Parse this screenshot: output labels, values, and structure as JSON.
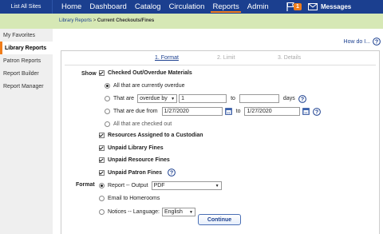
{
  "topbar": {
    "site": "List All Sites",
    "nav": [
      "Home",
      "Dashboard",
      "Catalog",
      "Circulation",
      "Reports",
      "Admin"
    ],
    "active_nav": "Reports",
    "badge": "1",
    "messages": "Messages"
  },
  "breadcrumb": {
    "parent": "Library Reports",
    "sep": ">",
    "current": "Current Checkouts/Fines"
  },
  "sidebar": {
    "items": [
      "My Favorites",
      "Library Reports",
      "Patron Reports",
      "Report Builder",
      "Report Manager"
    ],
    "active": "Library Reports"
  },
  "howdo": "How do I...",
  "steps": [
    "1. Format",
    "2. Limit",
    "3. Details"
  ],
  "show": {
    "label": "Show",
    "checked_out": "Checked Out/Overdue Materials",
    "opt_all_overdue": "All that are currently overdue",
    "opt_that_are": "That are",
    "overdue_by": "overdue by",
    "overdue_from": "1",
    "to_label": "to",
    "overdue_to": "",
    "days": "days",
    "opt_due_from": "That are due from",
    "date_from": "1/27/2020",
    "date_to": "1/27/2020",
    "opt_all_checked_out": "All that are checked out",
    "custodian": "Resources Assigned to a Custodian",
    "library_fines": "Unpaid Library Fines",
    "resource_fines": "Unpaid Resource Fines",
    "patron_fines": "Unpaid Patron Fines"
  },
  "format": {
    "label": "Format",
    "report_output": "Report -- Output",
    "output_value": "PDF",
    "email": "Email to Homerooms",
    "notices": "Notices -- Language:",
    "language": "English"
  },
  "continue": "Continue",
  "colors": {
    "topbar": "#1b3f8f",
    "accent": "#f07d1b",
    "crumbbar": "#d6e8b5"
  }
}
